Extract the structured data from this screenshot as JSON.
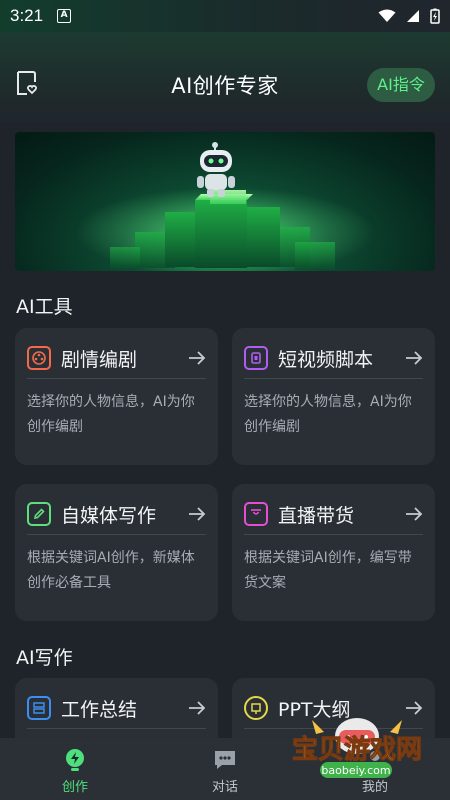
{
  "status_bar": {
    "time": "3:21",
    "badge": "A"
  },
  "header": {
    "title": "AI创作专家",
    "cmd_button": "AI指令"
  },
  "sections": {
    "tools_title": "AI工具",
    "writing_title": "AI写作"
  },
  "tool_cards": [
    {
      "title": "剧情编剧",
      "desc": "选择你的人物信息，AI为你创作编剧",
      "icon": "film-reel-icon",
      "color": "#f26a4b"
    },
    {
      "title": "短视频脚本",
      "desc": "选择你的人物信息，AI为你创作编剧",
      "icon": "video-icon",
      "color": "#b05ef0"
    },
    {
      "title": "自媒体写作",
      "desc": "根据关键词AI创作，新媒体创作必备工具",
      "icon": "pencil-icon",
      "color": "#5de07a"
    },
    {
      "title": "直播带货",
      "desc": "根据关键词AI创作，编写带货文案",
      "icon": "shopping-bag-icon",
      "color": "#e34fd0"
    }
  ],
  "writing_cards": [
    {
      "title": "工作总结",
      "icon": "layout-icon",
      "color": "#3a8ff0"
    },
    {
      "title": "PPT大纲",
      "icon": "presentation-icon",
      "color": "#e4d84a"
    }
  ],
  "bottom_nav": [
    {
      "label": "创作",
      "icon": "bulb-icon",
      "active": true
    },
    {
      "label": "对话",
      "icon": "chat-icon",
      "active": false
    },
    {
      "label": "我的",
      "icon": "user-icon",
      "active": false
    }
  ],
  "watermark": {
    "text": "宝贝游戏网",
    "url": "baobeiy.com"
  },
  "colors": {
    "accent": "#5df08b",
    "background": "#1f242b",
    "card": "#2a2f36",
    "nav": "#2b3037"
  }
}
